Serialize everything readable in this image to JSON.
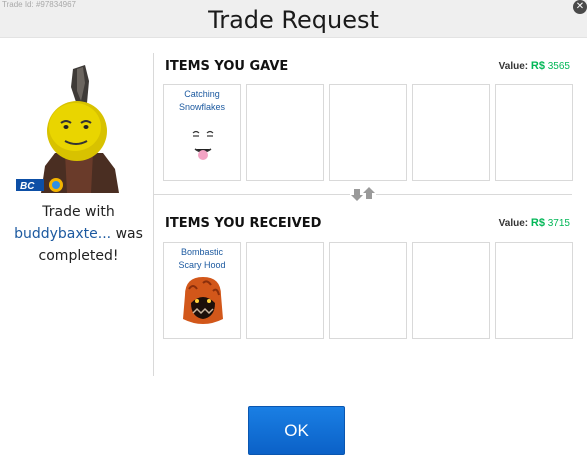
{
  "header": {
    "trade_id": "Trade Id: #97834967",
    "title": "Trade Request"
  },
  "left": {
    "avatar_badge": "BC",
    "msg_prefix": "Trade with",
    "username": "buddybaxte...",
    "msg_suffix_1": "was",
    "msg_suffix_2": "completed!"
  },
  "gave": {
    "title": "ITEMS YOU GAVE",
    "value_label": "Value:",
    "currency": "R$",
    "value": "3565",
    "items": [
      {
        "name": "Catching Snowflakes",
        "icon": "snowflake-face-icon"
      },
      {
        "name": ""
      },
      {
        "name": ""
      },
      {
        "name": ""
      },
      {
        "name": ""
      }
    ]
  },
  "received": {
    "title": "ITEMS YOU RECEIVED",
    "value_label": "Value:",
    "currency": "R$",
    "value": "3715",
    "items": [
      {
        "name": "Bombastic Scary Hood",
        "icon": "scary-hood-icon"
      },
      {
        "name": ""
      },
      {
        "name": ""
      },
      {
        "name": ""
      },
      {
        "name": ""
      }
    ]
  },
  "footer": {
    "ok_label": "OK"
  },
  "colors": {
    "accent": "#0b61c7",
    "robux_green": "#02b757",
    "link": "#1d5aa0"
  }
}
